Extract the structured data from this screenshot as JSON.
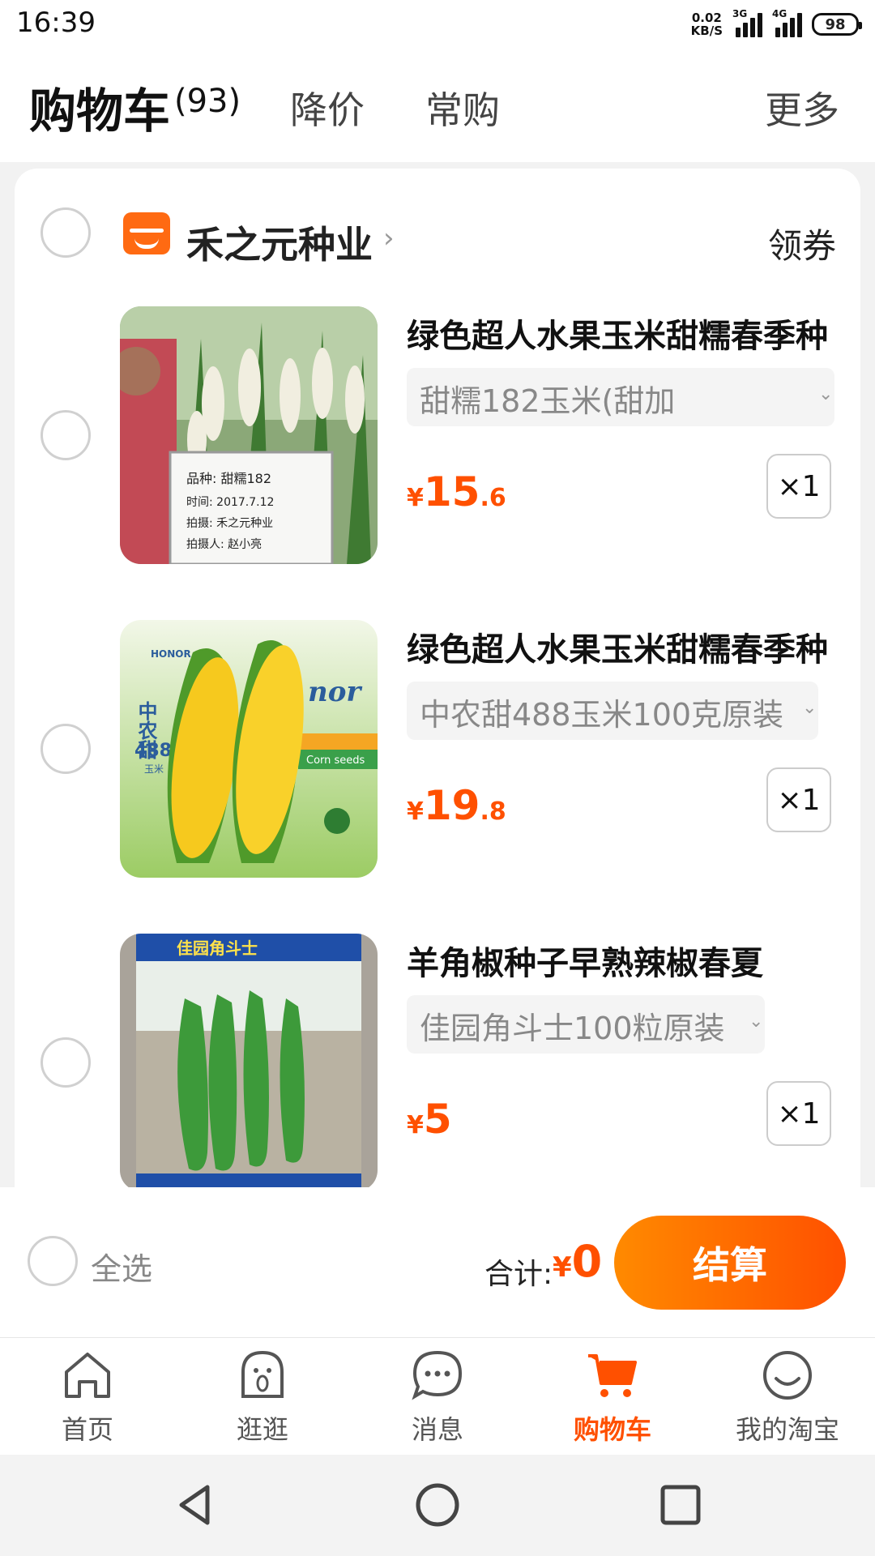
{
  "status_bar": {
    "time": "16:39",
    "net_speed_value": "0.02",
    "net_speed_unit": "KB/S",
    "signal1_label": "3G",
    "signal2_label": "4G",
    "battery": "98"
  },
  "header": {
    "title": "购物车",
    "count": "(93)",
    "tabs": [
      "降价",
      "常购"
    ],
    "more": "更多"
  },
  "store": {
    "name": "禾之元种业",
    "coupon": "领券"
  },
  "items": [
    {
      "title": "绿色超人水果玉米甜糯春季种",
      "spec": "甜糯182玉米(甜加",
      "price_symbol": "¥",
      "price_int": "15",
      "price_dec": ".6",
      "qty": "×1",
      "image_text": [
        "品种: 甜糯182",
        "时间: 2017.7.12",
        "拍摄: 禾之元种业",
        "拍摄人: 赵小亮"
      ]
    },
    {
      "title": "绿色超人水果玉米甜糯春季种",
      "spec": "中农甜488玉米100克原装",
      "price_symbol": "¥",
      "price_int": "19",
      "price_dec": ".8",
      "qty": "×1",
      "image_text": [
        "HONOR",
        "中农甜",
        "488",
        "玉米",
        "nor",
        "Corn seeds"
      ]
    },
    {
      "title": "羊角椒种子早熟辣椒春夏",
      "spec": "佳园角斗士100粒原装",
      "price_symbol": "¥",
      "price_int": "5",
      "price_dec": "",
      "qty": "×1",
      "image_text": [
        "佳园角斗士"
      ]
    }
  ],
  "checkout": {
    "select_all": "全选",
    "total_label": "合计:",
    "total_symbol": "¥",
    "total_value": "0",
    "button": "结算"
  },
  "tabbar": {
    "items": [
      {
        "label": "首页",
        "icon": "home-icon"
      },
      {
        "label": "逛逛",
        "icon": "explore-icon"
      },
      {
        "label": "消息",
        "icon": "message-icon"
      },
      {
        "label": "购物车",
        "icon": "cart-icon"
      },
      {
        "label": "我的淘宝",
        "icon": "profile-icon"
      }
    ],
    "active_index": 3
  },
  "colors": {
    "accent": "#ff5000",
    "accent_light": "#ff8a00"
  }
}
